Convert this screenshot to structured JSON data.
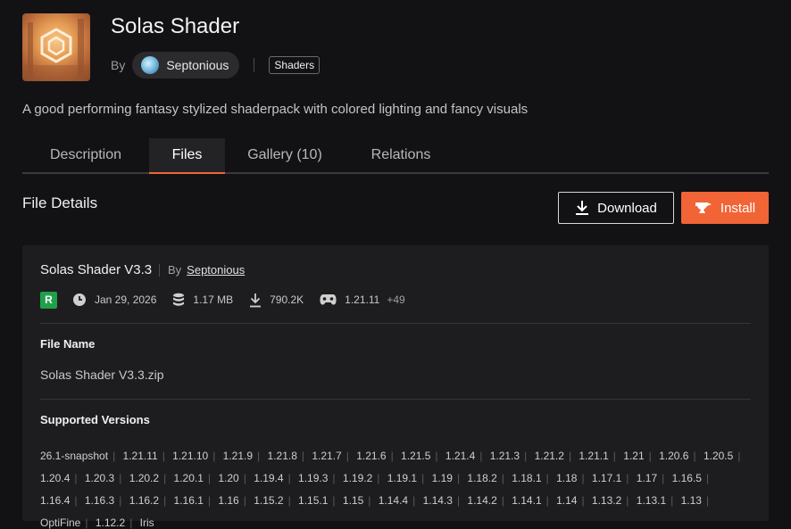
{
  "project": {
    "title": "Solas Shader",
    "by_label": "By",
    "author": "Septonious",
    "tag": "Shaders",
    "summary": "A good performing fantasy stylized shaderpack with colored lighting and fancy visuals"
  },
  "tabs": [
    {
      "label": "Description",
      "active": false
    },
    {
      "label": "Files",
      "active": true
    },
    {
      "label": "Gallery (10)",
      "active": false
    },
    {
      "label": "Relations",
      "active": false
    }
  ],
  "file_details": {
    "section_title": "File Details",
    "download_label": "Download",
    "install_label": "Install",
    "file": {
      "title": "Solas Shader V3.3",
      "by_label": "By",
      "author": "Septonious",
      "release_badge": "R",
      "date": "Jan 29, 2026",
      "size": "1.17 MB",
      "downloads": "790.2K",
      "game_version": "1.21.11",
      "more_versions": "+49"
    },
    "file_name_label": "File Name",
    "file_name": "Solas Shader V3.3.zip",
    "supported_versions_label": "Supported Versions",
    "supported_versions": [
      "26.1-snapshot",
      "1.21.11",
      "1.21.10",
      "1.21.9",
      "1.21.8",
      "1.21.7",
      "1.21.6",
      "1.21.5",
      "1.21.4",
      "1.21.3",
      "1.21.2",
      "1.21.1",
      "1.21",
      "1.20.6",
      "1.20.5",
      "1.20.4",
      "1.20.3",
      "1.20.2",
      "1.20.1",
      "1.20",
      "1.19.4",
      "1.19.3",
      "1.19.2",
      "1.19.1",
      "1.19",
      "1.18.2",
      "1.18.1",
      "1.18",
      "1.17.1",
      "1.17",
      "1.16.5",
      "1.16.4",
      "1.16.3",
      "1.16.2",
      "1.16.1",
      "1.16",
      "1.15.2",
      "1.15.1",
      "1.15",
      "1.14.4",
      "1.14.3",
      "1.14.2",
      "1.14.1",
      "1.14",
      "1.13.2",
      "1.13.1",
      "1.13",
      "OptiFine",
      "1.12.2",
      "Iris"
    ]
  },
  "colors": {
    "accent": "#f16436",
    "release_green": "#1fa04a",
    "background": "#121214",
    "card": "#1d1d20"
  },
  "icons": {
    "date": "clock-icon",
    "size": "database-icon",
    "downloads": "download-icon",
    "game_version": "gamepad-icon",
    "install": "anvil-icon"
  }
}
